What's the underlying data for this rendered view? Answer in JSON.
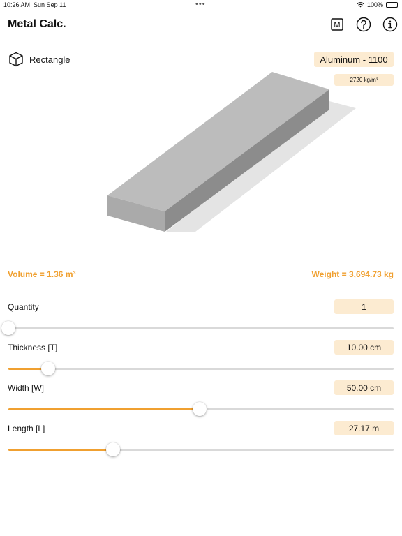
{
  "status_bar": {
    "time": "10:26 AM",
    "date": "Sun Sep 11",
    "battery": "100%",
    "wifi_icon": "wifi-icon",
    "battery_icon": "battery-icon"
  },
  "header": {
    "title": "Metal Calc.",
    "m_button": "M",
    "icons": [
      "m-icon",
      "help-icon",
      "info-icon"
    ]
  },
  "shape": {
    "label": "Rectangle",
    "icon": "cube-icon"
  },
  "material": {
    "name": "Aluminum - 1100",
    "density": "2720 kg/m³"
  },
  "results": {
    "volume": "Volume = 1.36 m³",
    "weight": "Weight = 3,694.73 kg"
  },
  "params": [
    {
      "label": "Quantity",
      "value": "1",
      "level": 0.0
    },
    {
      "label": "Thickness [T]",
      "value": "10.00 cm",
      "level": 0.104
    },
    {
      "label": "Width [W]",
      "value": "50.00 cm",
      "level": 0.497
    },
    {
      "label": "Length [L]",
      "value": "27.17 m",
      "level": 0.271
    }
  ],
  "colors": {
    "accent": "#f0a030",
    "badge_bg": "#fcebd1",
    "track": "#d9d9d9"
  }
}
